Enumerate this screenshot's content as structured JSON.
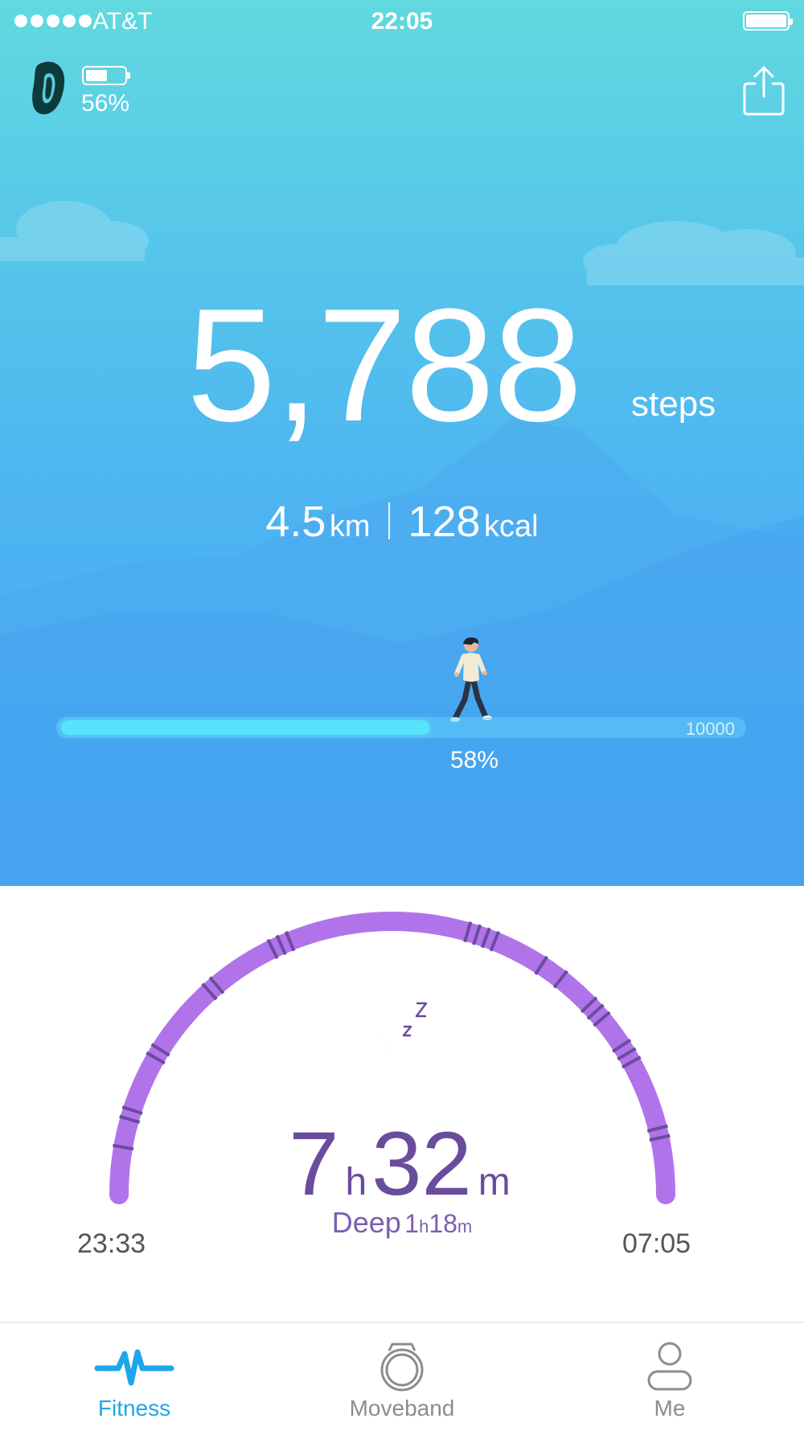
{
  "status_bar": {
    "carrier": "AT&T",
    "time": "22:05",
    "signal_bars": 5
  },
  "device": {
    "icon": "band-icon",
    "battery_percent": "56%",
    "battery_level": 0.56
  },
  "header": {
    "share_icon": "share-icon"
  },
  "activity": {
    "steps": "5,788",
    "steps_unit": "steps",
    "distance": "4.5",
    "distance_unit": "km",
    "calories": "128",
    "calories_unit": "kcal",
    "goal": "10000",
    "progress_label": "58%",
    "progress": 0.58
  },
  "sleep": {
    "icon": "moon-zzz-icon",
    "hours": "7",
    "hours_unit": "h",
    "minutes": "32",
    "minutes_unit": "m",
    "deep_label": "Deep",
    "deep_hours": "1",
    "deep_hours_unit": "h",
    "deep_minutes": "18",
    "deep_minutes_unit": "m",
    "start_time": "23:33",
    "end_time": "07:05",
    "colors": {
      "arc": "#b173ea",
      "deep": "#6a4c9c"
    }
  },
  "tabs": [
    {
      "label": "Fitness",
      "icon": "pulse-icon",
      "active": true
    },
    {
      "label": "Moveband",
      "icon": "band-device-icon",
      "active": false
    },
    {
      "label": "Me",
      "icon": "person-icon",
      "active": false
    }
  ],
  "colors": {
    "accent": "#1ea6ea",
    "hero_top": "#61d9df",
    "hero_bottom": "#4aa9f4",
    "progress": "#57e3fb"
  }
}
